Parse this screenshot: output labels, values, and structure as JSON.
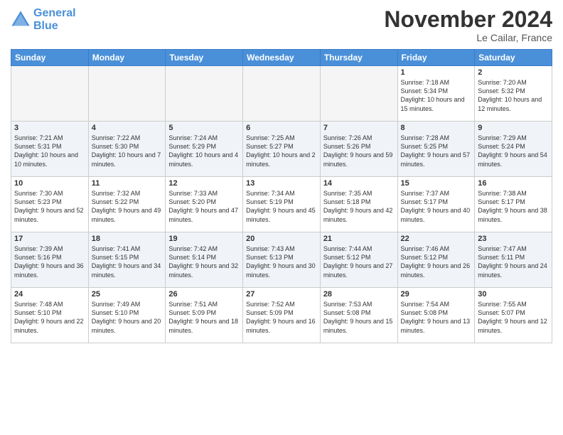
{
  "header": {
    "logo_line1": "General",
    "logo_line2": "Blue",
    "month": "November 2024",
    "location": "Le Cailar, France"
  },
  "weekdays": [
    "Sunday",
    "Monday",
    "Tuesday",
    "Wednesday",
    "Thursday",
    "Friday",
    "Saturday"
  ],
  "weeks": [
    [
      {
        "day": "",
        "info": ""
      },
      {
        "day": "",
        "info": ""
      },
      {
        "day": "",
        "info": ""
      },
      {
        "day": "",
        "info": ""
      },
      {
        "day": "",
        "info": ""
      },
      {
        "day": "1",
        "info": "Sunrise: 7:18 AM\nSunset: 5:34 PM\nDaylight: 10 hours and 15 minutes."
      },
      {
        "day": "2",
        "info": "Sunrise: 7:20 AM\nSunset: 5:32 PM\nDaylight: 10 hours and 12 minutes."
      }
    ],
    [
      {
        "day": "3",
        "info": "Sunrise: 7:21 AM\nSunset: 5:31 PM\nDaylight: 10 hours and 10 minutes."
      },
      {
        "day": "4",
        "info": "Sunrise: 7:22 AM\nSunset: 5:30 PM\nDaylight: 10 hours and 7 minutes."
      },
      {
        "day": "5",
        "info": "Sunrise: 7:24 AM\nSunset: 5:29 PM\nDaylight: 10 hours and 4 minutes."
      },
      {
        "day": "6",
        "info": "Sunrise: 7:25 AM\nSunset: 5:27 PM\nDaylight: 10 hours and 2 minutes."
      },
      {
        "day": "7",
        "info": "Sunrise: 7:26 AM\nSunset: 5:26 PM\nDaylight: 9 hours and 59 minutes."
      },
      {
        "day": "8",
        "info": "Sunrise: 7:28 AM\nSunset: 5:25 PM\nDaylight: 9 hours and 57 minutes."
      },
      {
        "day": "9",
        "info": "Sunrise: 7:29 AM\nSunset: 5:24 PM\nDaylight: 9 hours and 54 minutes."
      }
    ],
    [
      {
        "day": "10",
        "info": "Sunrise: 7:30 AM\nSunset: 5:23 PM\nDaylight: 9 hours and 52 minutes."
      },
      {
        "day": "11",
        "info": "Sunrise: 7:32 AM\nSunset: 5:22 PM\nDaylight: 9 hours and 49 minutes."
      },
      {
        "day": "12",
        "info": "Sunrise: 7:33 AM\nSunset: 5:20 PM\nDaylight: 9 hours and 47 minutes."
      },
      {
        "day": "13",
        "info": "Sunrise: 7:34 AM\nSunset: 5:19 PM\nDaylight: 9 hours and 45 minutes."
      },
      {
        "day": "14",
        "info": "Sunrise: 7:35 AM\nSunset: 5:18 PM\nDaylight: 9 hours and 42 minutes."
      },
      {
        "day": "15",
        "info": "Sunrise: 7:37 AM\nSunset: 5:17 PM\nDaylight: 9 hours and 40 minutes."
      },
      {
        "day": "16",
        "info": "Sunrise: 7:38 AM\nSunset: 5:17 PM\nDaylight: 9 hours and 38 minutes."
      }
    ],
    [
      {
        "day": "17",
        "info": "Sunrise: 7:39 AM\nSunset: 5:16 PM\nDaylight: 9 hours and 36 minutes."
      },
      {
        "day": "18",
        "info": "Sunrise: 7:41 AM\nSunset: 5:15 PM\nDaylight: 9 hours and 34 minutes."
      },
      {
        "day": "19",
        "info": "Sunrise: 7:42 AM\nSunset: 5:14 PM\nDaylight: 9 hours and 32 minutes."
      },
      {
        "day": "20",
        "info": "Sunrise: 7:43 AM\nSunset: 5:13 PM\nDaylight: 9 hours and 30 minutes."
      },
      {
        "day": "21",
        "info": "Sunrise: 7:44 AM\nSunset: 5:12 PM\nDaylight: 9 hours and 27 minutes."
      },
      {
        "day": "22",
        "info": "Sunrise: 7:46 AM\nSunset: 5:12 PM\nDaylight: 9 hours and 26 minutes."
      },
      {
        "day": "23",
        "info": "Sunrise: 7:47 AM\nSunset: 5:11 PM\nDaylight: 9 hours and 24 minutes."
      }
    ],
    [
      {
        "day": "24",
        "info": "Sunrise: 7:48 AM\nSunset: 5:10 PM\nDaylight: 9 hours and 22 minutes."
      },
      {
        "day": "25",
        "info": "Sunrise: 7:49 AM\nSunset: 5:10 PM\nDaylight: 9 hours and 20 minutes."
      },
      {
        "day": "26",
        "info": "Sunrise: 7:51 AM\nSunset: 5:09 PM\nDaylight: 9 hours and 18 minutes."
      },
      {
        "day": "27",
        "info": "Sunrise: 7:52 AM\nSunset: 5:09 PM\nDaylight: 9 hours and 16 minutes."
      },
      {
        "day": "28",
        "info": "Sunrise: 7:53 AM\nSunset: 5:08 PM\nDaylight: 9 hours and 15 minutes."
      },
      {
        "day": "29",
        "info": "Sunrise: 7:54 AM\nSunset: 5:08 PM\nDaylight: 9 hours and 13 minutes."
      },
      {
        "day": "30",
        "info": "Sunrise: 7:55 AM\nSunset: 5:07 PM\nDaylight: 9 hours and 12 minutes."
      }
    ]
  ]
}
